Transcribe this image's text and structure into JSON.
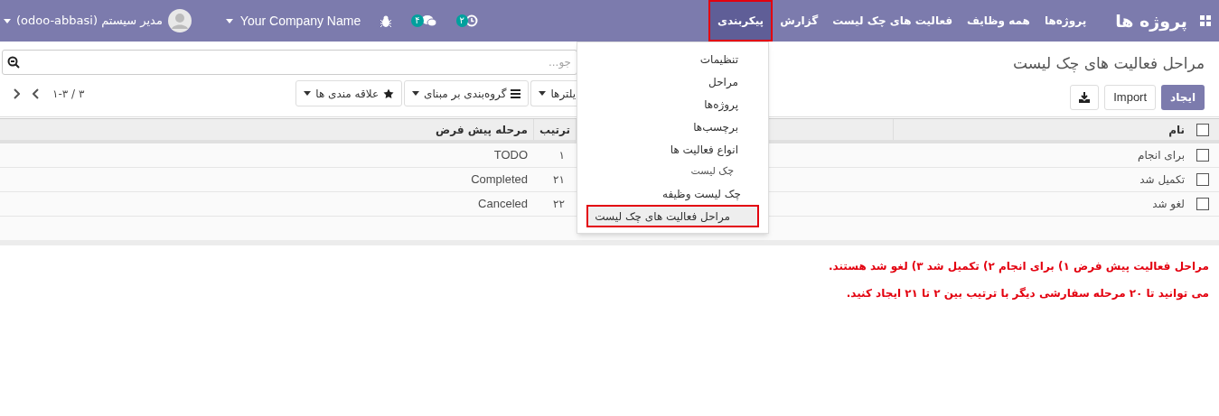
{
  "navbar": {
    "app_title": "پروژه ها",
    "menu": [
      {
        "label": "پروژه‌ها",
        "selected": false
      },
      {
        "label": "همه وظایف",
        "selected": false
      },
      {
        "label": "فعالیت های چک لیست",
        "selected": false
      },
      {
        "label": "گزارش",
        "selected": false
      },
      {
        "label": "پیکربندی",
        "selected": true
      }
    ],
    "activity_badge": "۲",
    "messages_badge": "۴",
    "company": "Your Company Name",
    "user": "مدیر سیستم (odoo-abbasi)"
  },
  "config_menu": [
    {
      "kind": "item",
      "label": "تنظیمات",
      "selected": false
    },
    {
      "kind": "item",
      "label": "مراحل",
      "selected": false
    },
    {
      "kind": "item",
      "label": "پروژه‌ها",
      "selected": false
    },
    {
      "kind": "item",
      "label": "برچسب‌ها",
      "selected": false
    },
    {
      "kind": "item",
      "label": "انواع فعالیت ها",
      "selected": false
    },
    {
      "kind": "header",
      "label": "چک لیست"
    },
    {
      "kind": "subitem",
      "label": "چک لیست وظیفه",
      "selected": false
    },
    {
      "kind": "subitem",
      "label": "مراحل فعالیت های چک لیست",
      "selected": true
    }
  ],
  "breadcrumb": "مراحل فعالیت های چک لیست",
  "buttons": {
    "create": "ایجاد",
    "import": "Import"
  },
  "search": {
    "placeholder": "جو..."
  },
  "search_options": [
    {
      "kind": "filter",
      "label": "یلترها"
    },
    {
      "kind": "groupby",
      "label": "گروه‌بندی بر مبنای"
    },
    {
      "kind": "favorites",
      "label": "علاقه مندی ها"
    }
  ],
  "pager": "۱-۳ / ۳",
  "table": {
    "all_checked": false,
    "columns": [
      "نام",
      "ترتیب",
      "مرحله پیش فرض"
    ],
    "rows": [
      {
        "name": "برای انجام",
        "sequence": "۱",
        "default_stage": "TODO",
        "checked": false
      },
      {
        "name": "تکمیل شد",
        "sequence": "۲۱",
        "default_stage": "Completed",
        "checked": false
      },
      {
        "name": "لغو شد",
        "sequence": "۲۲",
        "default_stage": "Canceled",
        "checked": false
      }
    ]
  },
  "notes": [
    "مراحل فعالیت پیش فرض ۱) برای انجام ۲) تکمیل شد ۳) لغو شد هستند.",
    "می توانید تا ۲۰ مرحله سفارشی دیگر با ترتیب بین ۲ تا ۲۱ ایجاد کنید."
  ]
}
